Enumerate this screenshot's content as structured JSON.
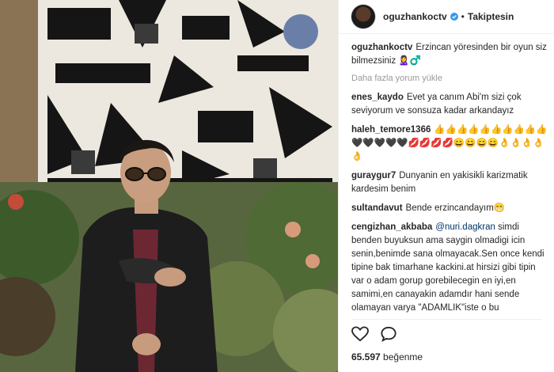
{
  "post": {
    "username": "oguzhankoctv",
    "separator": "•",
    "follow_state": "Takiptesin",
    "caption_user": "oguzhankoctv",
    "caption_text": "Erzincan yöresinden bir oyun siz bilmezsiniz 🙎‍♀️♂️",
    "load_more": "Daha fazla yorum yükle",
    "likes_count": "65.597",
    "likes_word": "beğenme"
  },
  "comments": [
    {
      "user": "enes_kaydo",
      "text": "Evet ya canım Abi'm sizi çok seviyorum ve sonsuza kadar arkandayız"
    },
    {
      "user": "haleh_temore1366",
      "text": "👍👍👍👍👍👍👍👍👍👍🖤🖤🖤🖤🖤💋💋💋💋😄😄😄😄👌👌👌👌👌"
    },
    {
      "user": "guraygur7",
      "text": "Dunyanin en yakisikli karizmatik kardesim benim"
    },
    {
      "user": "sultandavut",
      "text": "Bende erzincandayım😁"
    },
    {
      "user": "cengizhan_akbaba",
      "mention": "@nuri.dagkran",
      "text": "simdi benden buyuksun ama saygin olmadigi icin senin,benimde sana olmayacak.Sen once kendi tipine bak timarhane kackini.at hirsizi gibi tipin var o adam gorup gorebilecegin en iyi,en samimi,en canayakin adamdır hani sende olamayan varya \"ADAMLIK\"iste o bu"
    }
  ],
  "icons": [
    "verified-badge-icon",
    "heart-icon",
    "comment-icon"
  ],
  "colors": {
    "verified": "#3897f0",
    "text": "#262626",
    "muted": "#999999"
  }
}
